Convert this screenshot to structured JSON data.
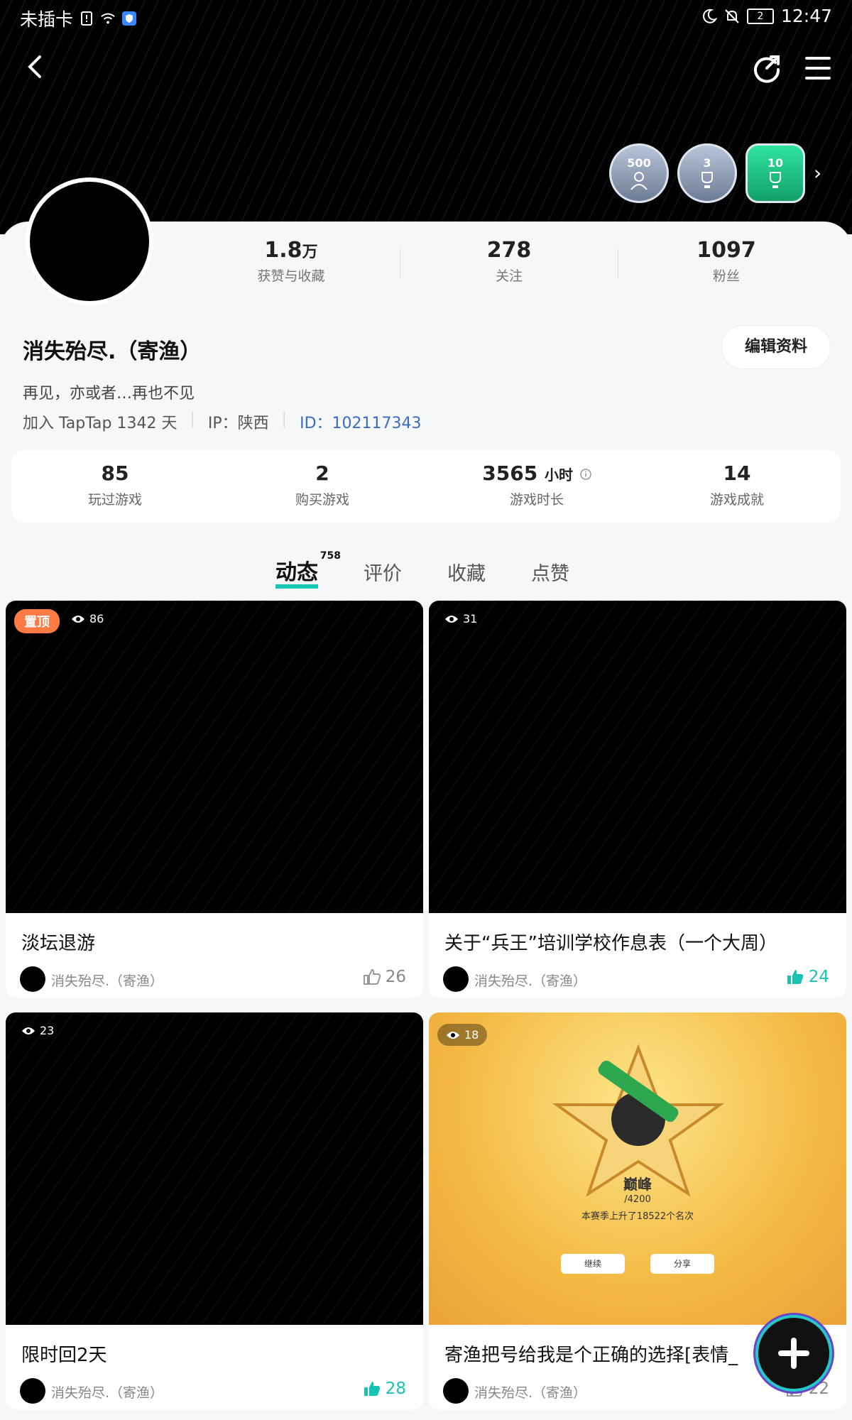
{
  "status_bar": {
    "carrier": "未插卡",
    "sim_count": "2",
    "time": "12:47"
  },
  "header": {
    "back_icon": "chevron-left-icon",
    "share_icon": "share-icon",
    "menu_icon": "menu-icon"
  },
  "badges": [
    {
      "num": "500",
      "icon": "user-upload-icon"
    },
    {
      "num": "3",
      "icon": "trophy-icon"
    },
    {
      "num": "10",
      "icon": "trophy-icon"
    }
  ],
  "profile": {
    "stats": [
      {
        "value": "1.8",
        "unit": "万",
        "label": "获赞与收藏"
      },
      {
        "value": "278",
        "unit": "",
        "label": "关注"
      },
      {
        "value": "1097",
        "unit": "",
        "label": "粉丝"
      }
    ],
    "username": "消失殆尽.（寄渔）",
    "edit_label": "编辑资料",
    "bio": "再见，亦或者…再也不见",
    "joined": "加入 TapTap 1342 天",
    "ip": "IP：陕西",
    "id": "ID：102117343"
  },
  "game_stats": [
    {
      "value": "85",
      "unit": "",
      "label": "玩过游戏"
    },
    {
      "value": "2",
      "unit": "",
      "label": "购买游戏"
    },
    {
      "value": "3565",
      "unit": "小时",
      "label": "游戏时长"
    },
    {
      "value": "14",
      "unit": "",
      "label": "游戏成就"
    }
  ],
  "tabs": [
    {
      "label": "动态",
      "count": "758"
    },
    {
      "label": "评价"
    },
    {
      "label": "收藏"
    },
    {
      "label": "点赞"
    }
  ],
  "posts": [
    {
      "pin": "置顶",
      "views": "86",
      "title": "淡坛退游",
      "author": "消失殆尽.（寄渔）",
      "likes": "26"
    },
    {
      "views": "31",
      "title": "关于“兵王”培训学校作息表（一个大周）",
      "author": "消失殆尽.（寄渔）",
      "likes": "24"
    },
    {
      "views": "23",
      "title": "限时回2天",
      "author": "消失殆尽.（寄渔）",
      "likes": "28"
    },
    {
      "views": "18",
      "title": "寄渔把号给我是个正确的选择[表情_",
      "author": "消失殆尽.（寄渔）",
      "likes": "22",
      "image_text": {
        "rank": "巅峰",
        "score": "/4200",
        "sub": "本赛季上升了18522个名次",
        "continue": "继续",
        "share": "分享"
      }
    }
  ],
  "colors": {
    "accent": "#16c7b8",
    "pin": "#ff7a45",
    "id_link": "#3c6cc2"
  }
}
